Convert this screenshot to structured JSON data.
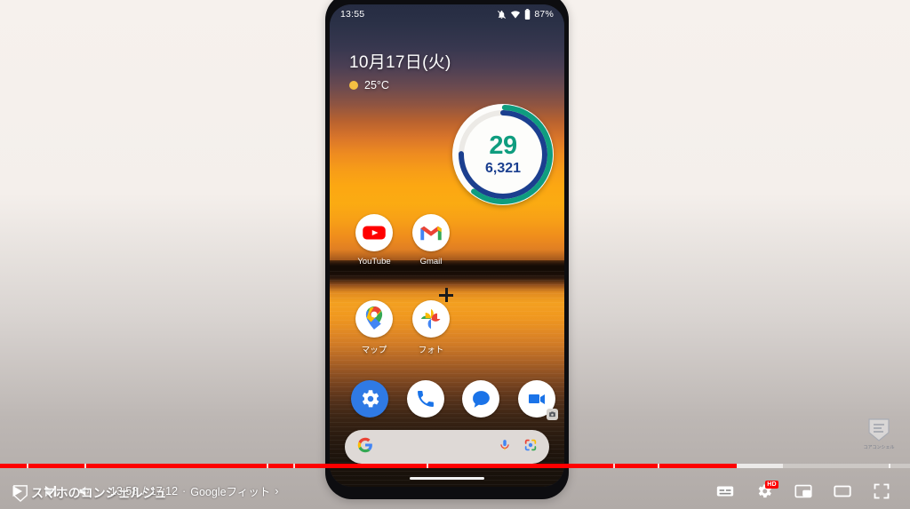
{
  "phone": {
    "status_bar": {
      "time": "13:55",
      "battery_pct": "87%",
      "icons": [
        "notifications-muted-icon",
        "wifi-icon",
        "battery-icon"
      ]
    },
    "home": {
      "date": "10月17日(火)",
      "temperature": "25°C",
      "weather_icon": "sun-icon",
      "fit_widget": {
        "move_minutes": "29",
        "steps": "6,321",
        "move_color": "#0f9d7f",
        "steps_color": "#1b3f8f"
      },
      "app_rows": [
        [
          {
            "name": "youtube",
            "label": "YouTube"
          },
          {
            "name": "gmail",
            "label": "Gmail"
          }
        ],
        [
          {
            "name": "maps",
            "label": "マップ"
          },
          {
            "name": "photos",
            "label": "フォト"
          }
        ]
      ],
      "dock": [
        {
          "name": "settings",
          "label": ""
        },
        {
          "name": "phone",
          "label": ""
        },
        {
          "name": "messages",
          "label": ""
        },
        {
          "name": "meet",
          "label": ""
        }
      ],
      "search_bar": {
        "google_icon": "google-g-icon",
        "mic_icon": "microphone-icon",
        "lens_icon": "google-lens-icon"
      }
    }
  },
  "player": {
    "progress": {
      "played_pct": 81,
      "loaded_pct": 86
    },
    "buttons": {
      "play": "play-icon",
      "next": "next-track-icon",
      "volume": "volume-icon",
      "subtitles": "subtitles-icon",
      "settings": "settings-gear-icon",
      "miniplayer": "miniplayer-icon",
      "theater": "theater-mode-icon",
      "fullscreen": "fullscreen-icon"
    },
    "time_current": "13:58",
    "time_total": "17:12",
    "time_separator": "/",
    "chapter_dot": "·",
    "chapter_title": "Googleフィット",
    "chapter_chevron": "›",
    "quality_badge": "HD",
    "channel_watermark": "スマホのコンシェルジュ",
    "corner_logo_text": "コアコンシェル"
  },
  "colors": {
    "progress_played": "#ff0000",
    "brand_red": "#ff0000",
    "fit_green": "#0f9d7f",
    "fit_blue": "#1b3f8f"
  }
}
